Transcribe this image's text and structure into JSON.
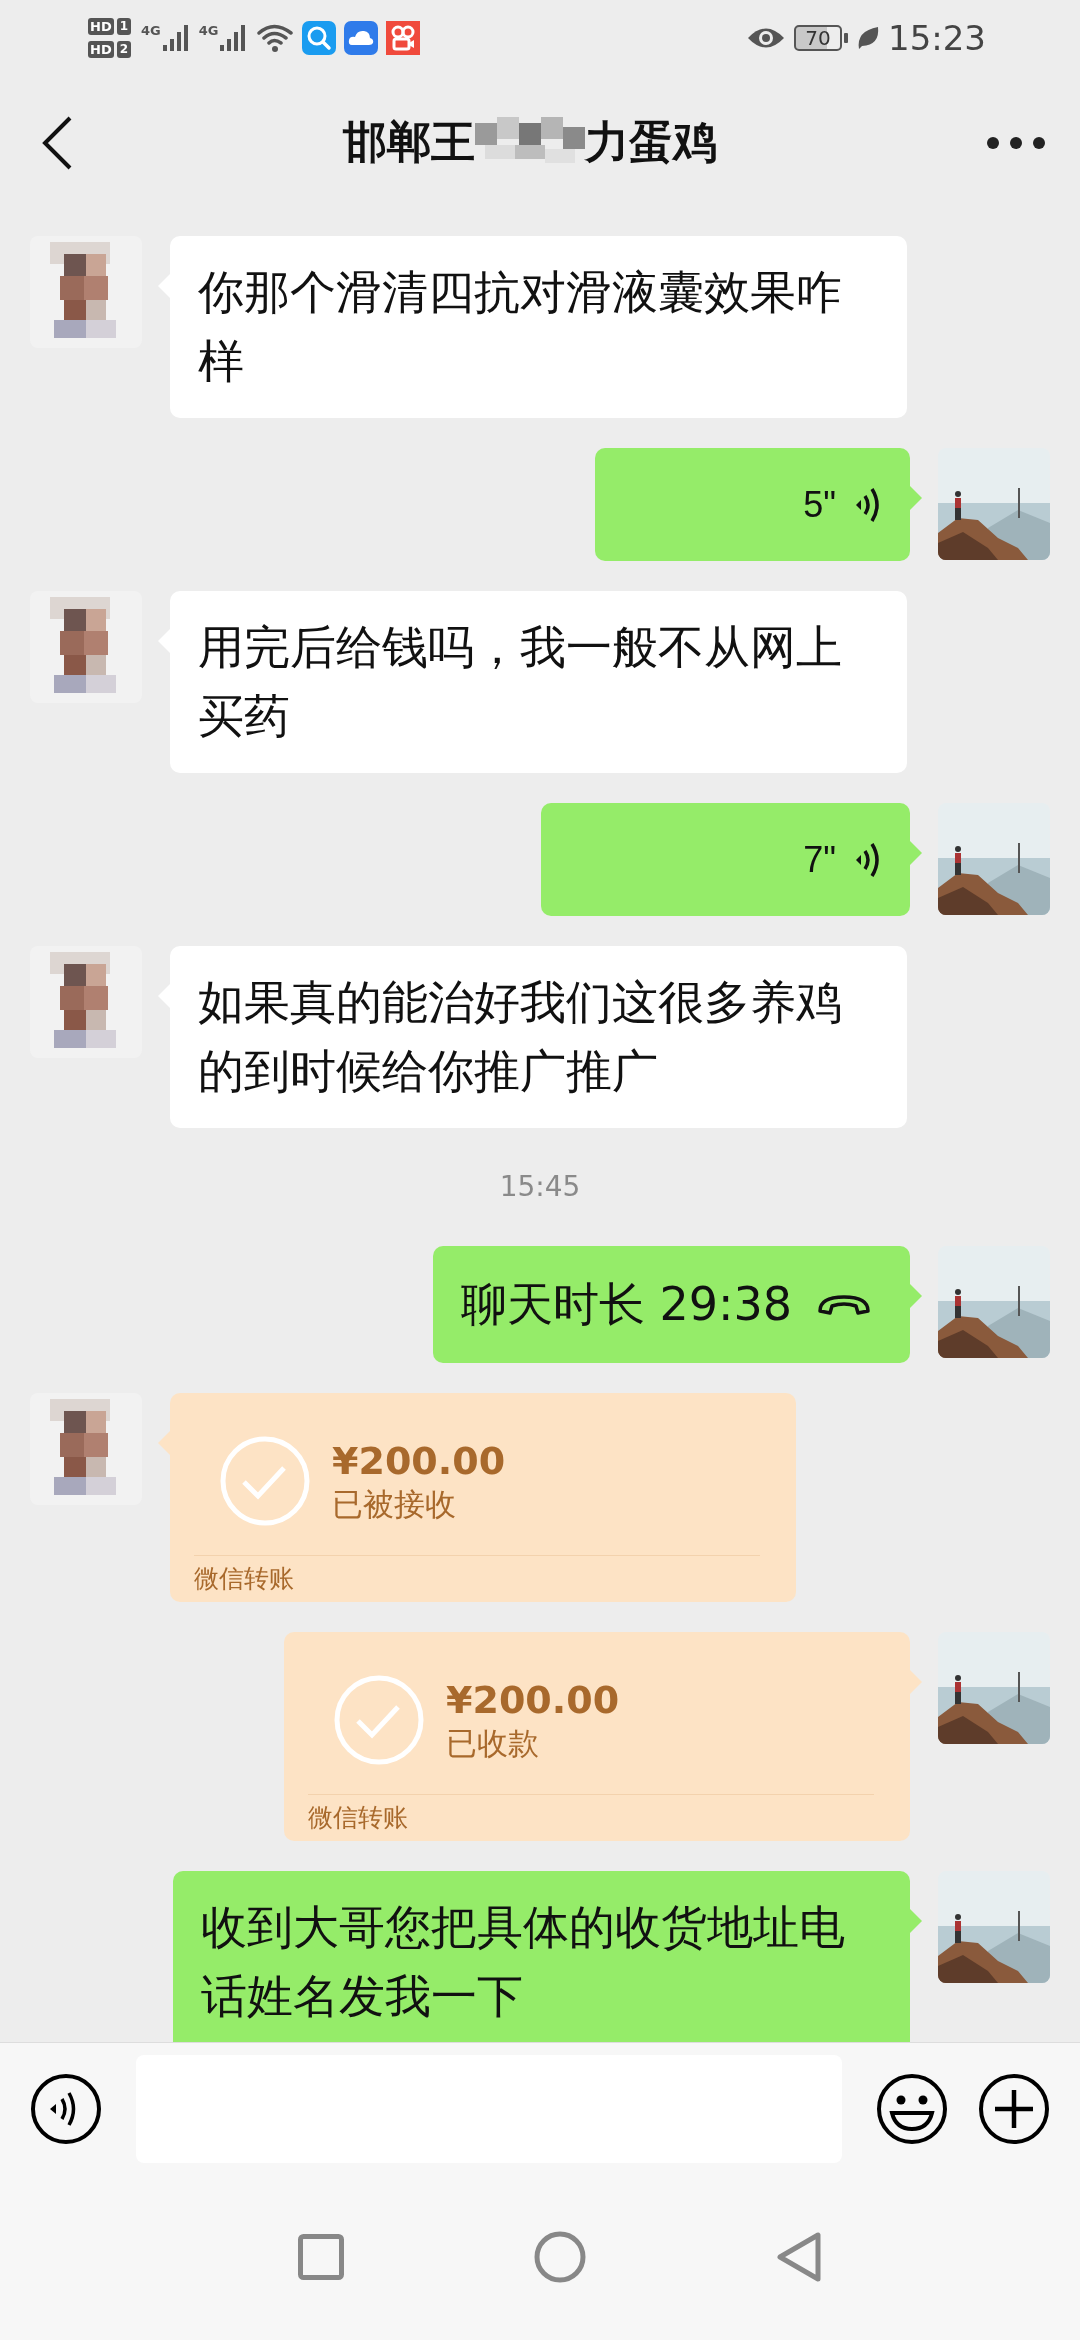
{
  "status_bar": {
    "sims": [
      {
        "label": "HD",
        "slot": "1"
      },
      {
        "label": "HD",
        "slot": "2"
      }
    ],
    "networks": [
      "4G",
      "4G"
    ],
    "battery": "70",
    "time": "15:23"
  },
  "header": {
    "title_parts": [
      "邯郸王",
      "力蛋鸡"
    ]
  },
  "messages": [
    {
      "kind": "text",
      "outgoing": false,
      "text": "你那个滑清四抗对滑液囊效果咋样"
    },
    {
      "kind": "voice",
      "outgoing": true,
      "duration": "5\""
    },
    {
      "kind": "text",
      "outgoing": false,
      "text": "用完后给钱吗，我一般不从网上买药"
    },
    {
      "kind": "voice",
      "outgoing": true,
      "duration": "7\""
    },
    {
      "kind": "text",
      "outgoing": false,
      "text": "如果真的能治好我们这很多养鸡的到时候给你推广推广"
    },
    {
      "kind": "time",
      "text": "15:45"
    },
    {
      "kind": "call",
      "outgoing": true,
      "text": "聊天时长 29:38"
    },
    {
      "kind": "transfer",
      "outgoing": false,
      "amount": "¥200.00",
      "status": "已被接收",
      "footer": "微信转账"
    },
    {
      "kind": "transfer",
      "outgoing": true,
      "amount": "¥200.00",
      "status": "已收款",
      "footer": "微信转账"
    },
    {
      "kind": "text",
      "outgoing": true,
      "text": "收到大哥您把具体的收货地址电话姓名发我一下"
    }
  ]
}
